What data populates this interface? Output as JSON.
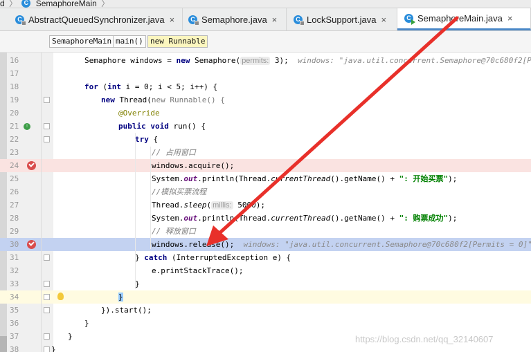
{
  "breadcrumb": {
    "prefix": "d",
    "sep1": "〉",
    "file": "SemaphoreMain",
    "sep2": "〉"
  },
  "tabs": [
    {
      "label": "AbstractQueuedSynchronizer.java",
      "close": "×",
      "active": false
    },
    {
      "label": "Semaphore.java",
      "close": "×",
      "active": false
    },
    {
      "label": "LockSupport.java",
      "close": "×",
      "active": false
    },
    {
      "label": "SemaphoreMain.java",
      "close": "×",
      "active": true
    }
  ],
  "tab_icon_letter": "C",
  "nav": {
    "class": "SemaphoreMain",
    "method": "main()",
    "anon": "new Runnable"
  },
  "lines": {
    "n16": "16",
    "n17": "17",
    "n18": "18",
    "n19": "19",
    "n20": "20",
    "n21": "21",
    "n22": "22",
    "n23": "23",
    "n24": "24",
    "n25": "25",
    "n26": "26",
    "n27": "27",
    "n28": "28",
    "n29": "29",
    "n30": "30",
    "n31": "31",
    "n32": "32",
    "n33": "33",
    "n34": "34",
    "n35": "35",
    "n36": "36",
    "n37": "37",
    "n38": "38"
  },
  "code": {
    "l16_a": "Semaphore windows = ",
    "l16_kw": "new",
    "l16_b": " Semaphore(",
    "l16_hint": "permits:",
    "l16_c": " 3);",
    "l16_dbg": "windows: \"java.util.concurrent.Semaphore@70c680f2[Permits = 0]\"",
    "l18_kw1": "for",
    "l18_a": " (",
    "l18_kw2": "int",
    "l18_b": " i = 0; i < 5; i++) {",
    "l19_kw": "new",
    "l19_a": " Thread(",
    "l19_b": "new Runnable() {",
    "l20_ann": "@Override",
    "l21_kw1": "public",
    "l21_kw2": "void",
    "l21_a": " run() {",
    "l22_kw": "try",
    "l22_a": " {",
    "l23_cmt": "// 占用窗口",
    "l24_a": "windows.acquire();",
    "l25_a": "System.",
    "l25_fld": "out",
    "l25_b": ".println(Thread.",
    "l25_it": "currentThread",
    "l25_c": "().getName() + ",
    "l25_str": "\": 开始买票\"",
    "l25_d": ");",
    "l26_cmt": "//模拟买票流程",
    "l27_a": "Thread.",
    "l27_it": "sleep",
    "l27_b": "(",
    "l27_hint": "millis:",
    "l27_c": " 5000);",
    "l28_a": "System.",
    "l28_fld": "out",
    "l28_b": ".println(Thread.",
    "l28_it": "currentThread",
    "l28_c": "().getName() + ",
    "l28_str": "\": 购票成功\"",
    "l28_d": ");",
    "l29_cmt": "// 释放窗口",
    "l30_a": "windows.release();",
    "l30_dbg": "windows: \"java.util.concurrent.Semaphore@70c680f2[Permits = 0]\"",
    "l31_a": "} ",
    "l31_kw": "catch",
    "l31_b": " (InterruptedException e) {",
    "l32_a": "e.printStackTrace();",
    "l33_a": "}",
    "l34_a": "}",
    "l35_a": "}).start();",
    "l36_a": "}",
    "l37_a": "}",
    "l38_a": "}"
  },
  "watermark": "https://blog.csdn.net/qq_32140607",
  "colors": {
    "arrow": "#e8302a",
    "breakpoint": "#d94c4c",
    "selection": "#c3d2f1",
    "keyword": "#000080",
    "string": "#008000"
  }
}
